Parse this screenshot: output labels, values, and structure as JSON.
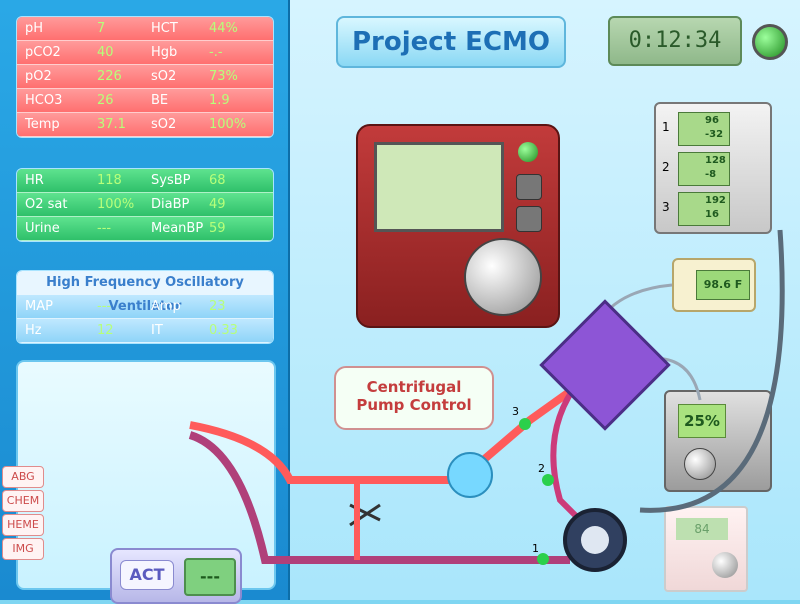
{
  "title": "Project ECMO",
  "timer": "0:12:34",
  "labs": [
    {
      "l1": "pH",
      "v1": "7",
      "l2": "HCT",
      "v2": "44%"
    },
    {
      "l1": "pCO2",
      "v1": "40",
      "l2": "Hgb",
      "v2": "-.-"
    },
    {
      "l1": "pO2",
      "v1": "226",
      "l2": "sO2",
      "v2": "73%"
    },
    {
      "l1": "HCO3",
      "v1": "26",
      "l2": "BE",
      "v2": "1.9"
    },
    {
      "l1": "Temp",
      "v1": "37.1",
      "l2": "sO2",
      "v2": "100%"
    }
  ],
  "vitals": [
    {
      "l1": "HR",
      "v1": "118",
      "l2": "SysBP",
      "v2": "68"
    },
    {
      "l1": "O2 sat",
      "v1": "100%",
      "l2": "DiaBP",
      "v2": "49"
    },
    {
      "l1": "Urine",
      "v1": "---",
      "l2": "MeanBP",
      "v2": "59"
    }
  ],
  "hfov": {
    "title": "High Frequency Oscillatory Ventilator",
    "rows": [
      {
        "l1": "MAP",
        "v1": "---",
        "l2": "Amp",
        "v2": "23"
      },
      {
        "l1": "Hz",
        "v1": "12",
        "l2": "IT",
        "v2": "0.33"
      }
    ]
  },
  "side_tabs": [
    "ABG",
    "CHEM",
    "HEME",
    "IMG"
  ],
  "act": {
    "label": "ACT",
    "value": "---"
  },
  "pump_label": "Centrifugal\nPump Control",
  "monitors": [
    {
      "num": "1",
      "top": "96",
      "bottom": "-32"
    },
    {
      "num": "2",
      "top": "128",
      "bottom": "-8"
    },
    {
      "num": "3",
      "top": "192",
      "bottom": "16"
    }
  ],
  "temp_display": "98.6 F",
  "gas_percent": "25%",
  "heater_display": "84",
  "ports": [
    "1",
    "2",
    "3"
  ]
}
